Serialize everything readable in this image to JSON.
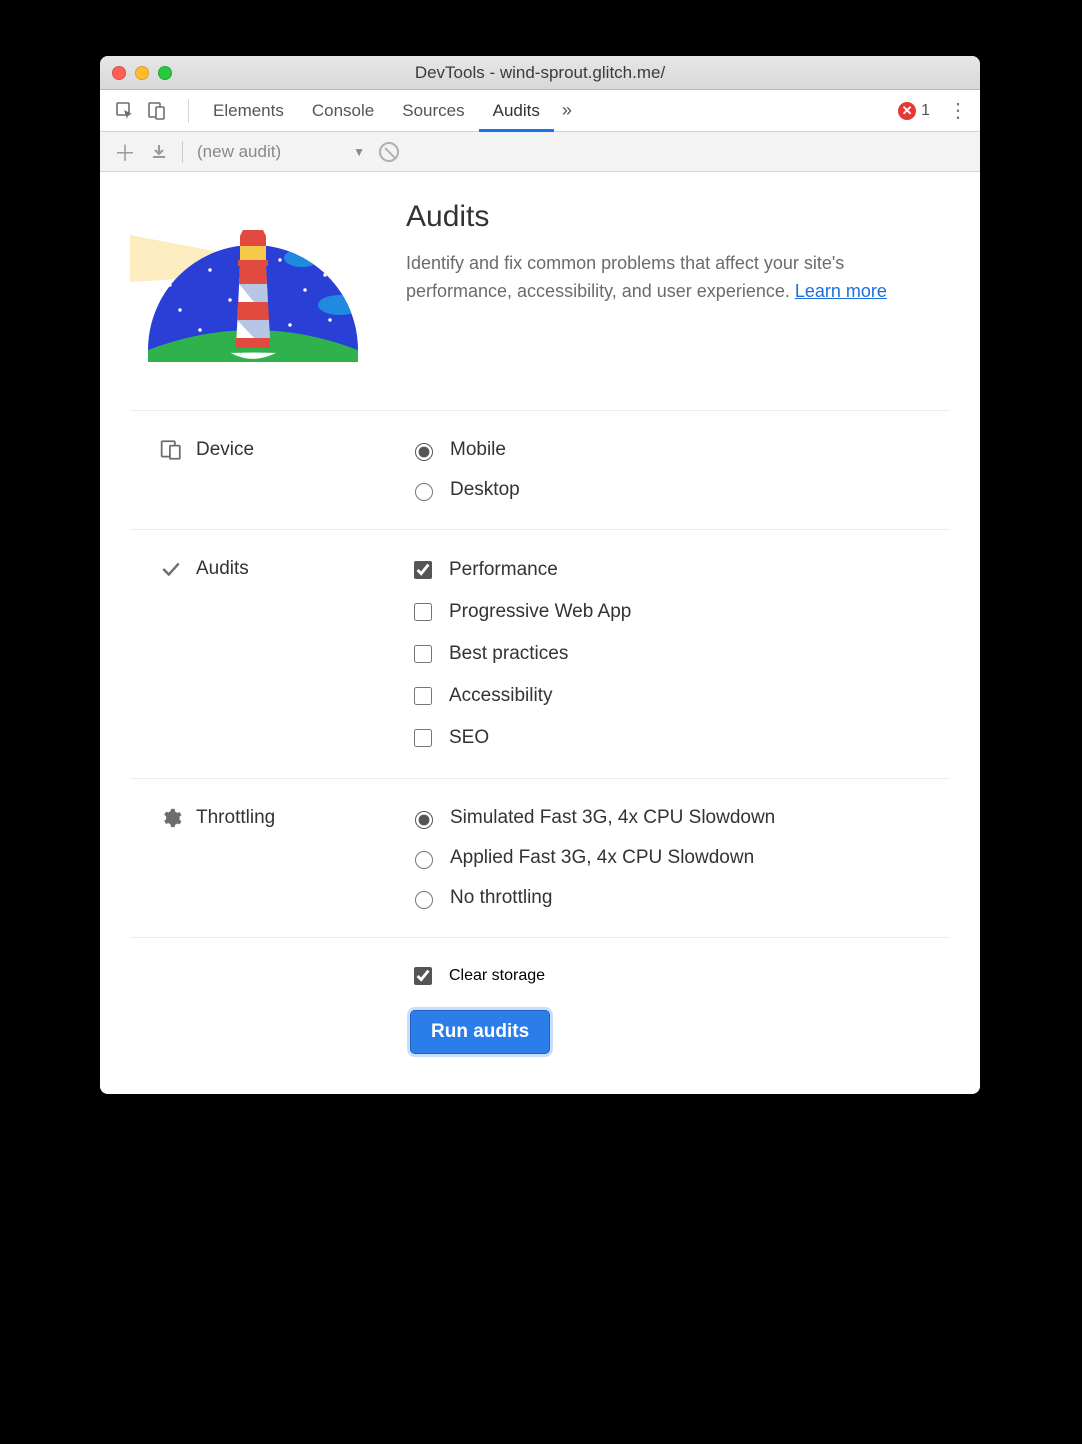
{
  "titlebar": {
    "title": "DevTools - wind-sprout.glitch.me/"
  },
  "tabs": {
    "elements": "Elements",
    "console": "Console",
    "sources": "Sources",
    "audits": "Audits"
  },
  "errors": {
    "count": "1"
  },
  "subtoolbar": {
    "dropdown_label": "(new audit)"
  },
  "hero": {
    "title": "Audits",
    "description_prefix": "Identify and fix common problems that affect your site's performance, accessibility, and user experience. ",
    "learn_more": "Learn more"
  },
  "sections": {
    "device": {
      "label": "Device",
      "mobile": "Mobile",
      "desktop": "Desktop"
    },
    "audits": {
      "label": "Audits",
      "performance": "Performance",
      "pwa": "Progressive Web App",
      "best_practices": "Best practices",
      "accessibility": "Accessibility",
      "seo": "SEO"
    },
    "throttling": {
      "label": "Throttling",
      "simulated": "Simulated Fast 3G, 4x CPU Slowdown",
      "applied": "Applied Fast 3G, 4x CPU Slowdown",
      "none": "No throttling"
    },
    "storage": {
      "clear": "Clear storage"
    }
  },
  "run_button": "Run audits"
}
